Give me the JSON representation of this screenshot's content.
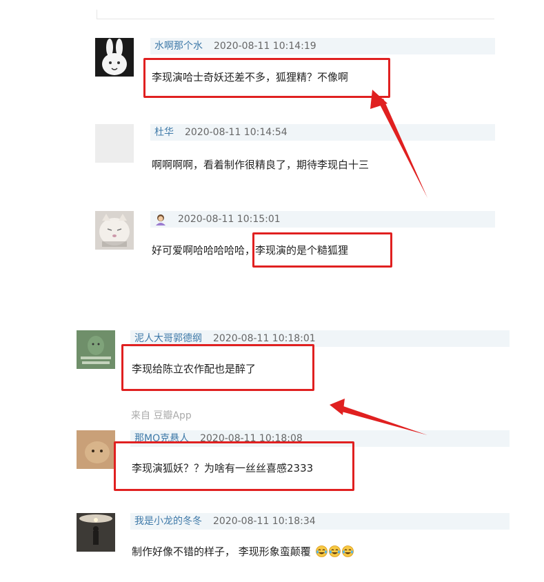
{
  "comments": [
    {
      "author": "水啊那个水",
      "time": "2020-08-11 10:14:19",
      "text": "李现演哈士奇妖还差不多，狐狸精？不像啊"
    },
    {
      "author": "杜华",
      "time": "2020-08-11 10:14:54",
      "text": "啊啊啊啊，看着制作很精良了，期待李现白十三"
    },
    {
      "author": "",
      "author_icon": "woman-emoji-icon",
      "time": "2020-08-11 10:15:01",
      "text": "好可爱啊哈哈哈哈哈，李现演的是个糙狐狸"
    },
    {
      "author": "泥人大哥郭德纲",
      "time": "2020-08-11 10:18:01",
      "text": "李现给陈立农作配也是醉了",
      "source": "来自 豆瓣App"
    },
    {
      "author": "那MO克悬人",
      "time": "2020-08-11 10:18:08",
      "text": "李现演狐妖？？为啥有一丝丝喜感2333"
    },
    {
      "author": "我是小龙的冬冬",
      "time": "2020-08-11 10:18:34",
      "text": "制作好像不错的样子， 李现形象蛮颠覆",
      "trailing_emoji": [
        "laughing-tears-emoji",
        "laughing-tears-emoji",
        "laughing-tears-emoji"
      ]
    }
  ],
  "colors": {
    "highlight": "#e02020",
    "author": "#3e79a8",
    "meta_bg": "#f0f5f8"
  }
}
